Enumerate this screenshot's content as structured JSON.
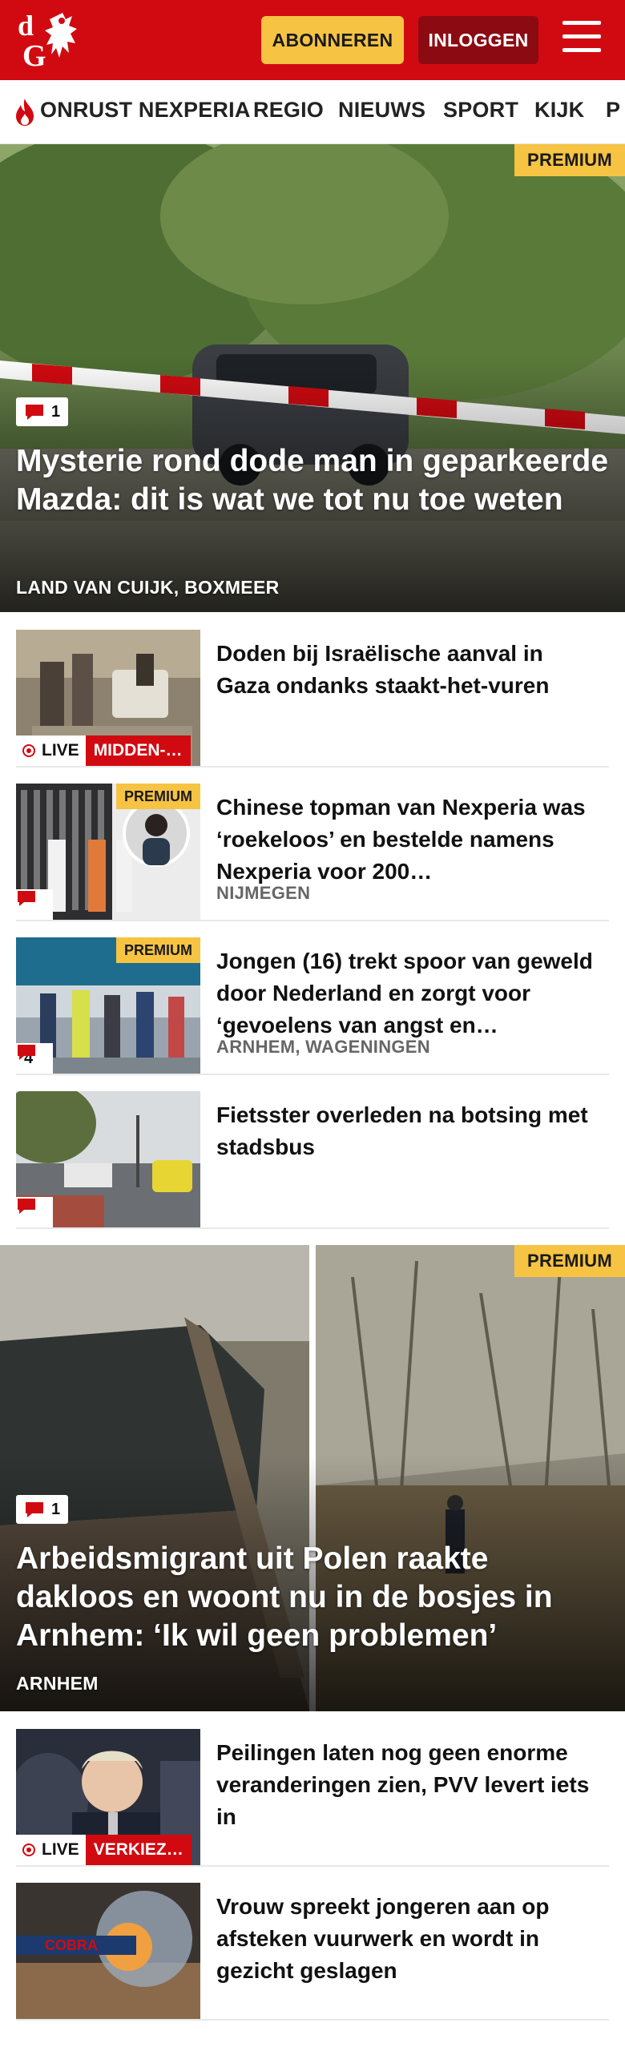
{
  "header": {
    "logo_text": "dG",
    "subscribe_label": "ABONNEREN",
    "login_label": "INLOGGEN",
    "brand_color": "#d10a11"
  },
  "nav": {
    "items": [
      {
        "label": "ONRUST NEXPERIA",
        "icon": "flame-icon"
      },
      {
        "label": "REGIO"
      },
      {
        "label": "NIEUWS"
      },
      {
        "label": "SPORT"
      },
      {
        "label": "KIJK"
      },
      {
        "label": "P"
      }
    ]
  },
  "hero1": {
    "badge": "PREMIUM",
    "comments": "1",
    "title": "Mysterie rond dode man in geparkeer­de Mazda: dit is wat we tot nu toe weten",
    "location": "LAND VAN CUIJK, BOXMEER"
  },
  "articles": [
    {
      "title": "Doden bij Israëlische aanval in Gaza ondanks staakt-het-vuren",
      "live": "LIVE",
      "tag": "MIDDEN-…"
    },
    {
      "badge": "PREMIUM",
      "title": "Chinese topman van Nexperia was ‘roekeloos’ en bestelde namens Nexperia voor 200…",
      "location": "NIJMEGEN"
    },
    {
      "badge": "PREMIUM",
      "comments": "4",
      "title": "Jongen (16) trekt spoor van geweld door Nederland en zorgt voor ‘gevoelens van angst en…",
      "location": "ARNHEM, WAGENINGEN"
    },
    {
      "title": "Fietsster overleden na botsing met stadsbus"
    }
  ],
  "hero2": {
    "badge": "PREMIUM",
    "comments": "1",
    "title": "Arbeidsmigrant uit Polen raakte dakloos en woont nu in de bosjes in Arnhem: ‘Ik wil geen problemen’",
    "location": "ARNHEM"
  },
  "articles2": [
    {
      "title": "Peilingen laten nog geen enorme veranderingen zien, PVV levert iets in",
      "live": "LIVE",
      "tag": "VERKIEZ…"
    },
    {
      "title": "Vrouw spreekt jongeren aan op afsteken vuurwerk en wordt in gezicht geslagen",
      "image_text": "COBRA"
    }
  ]
}
